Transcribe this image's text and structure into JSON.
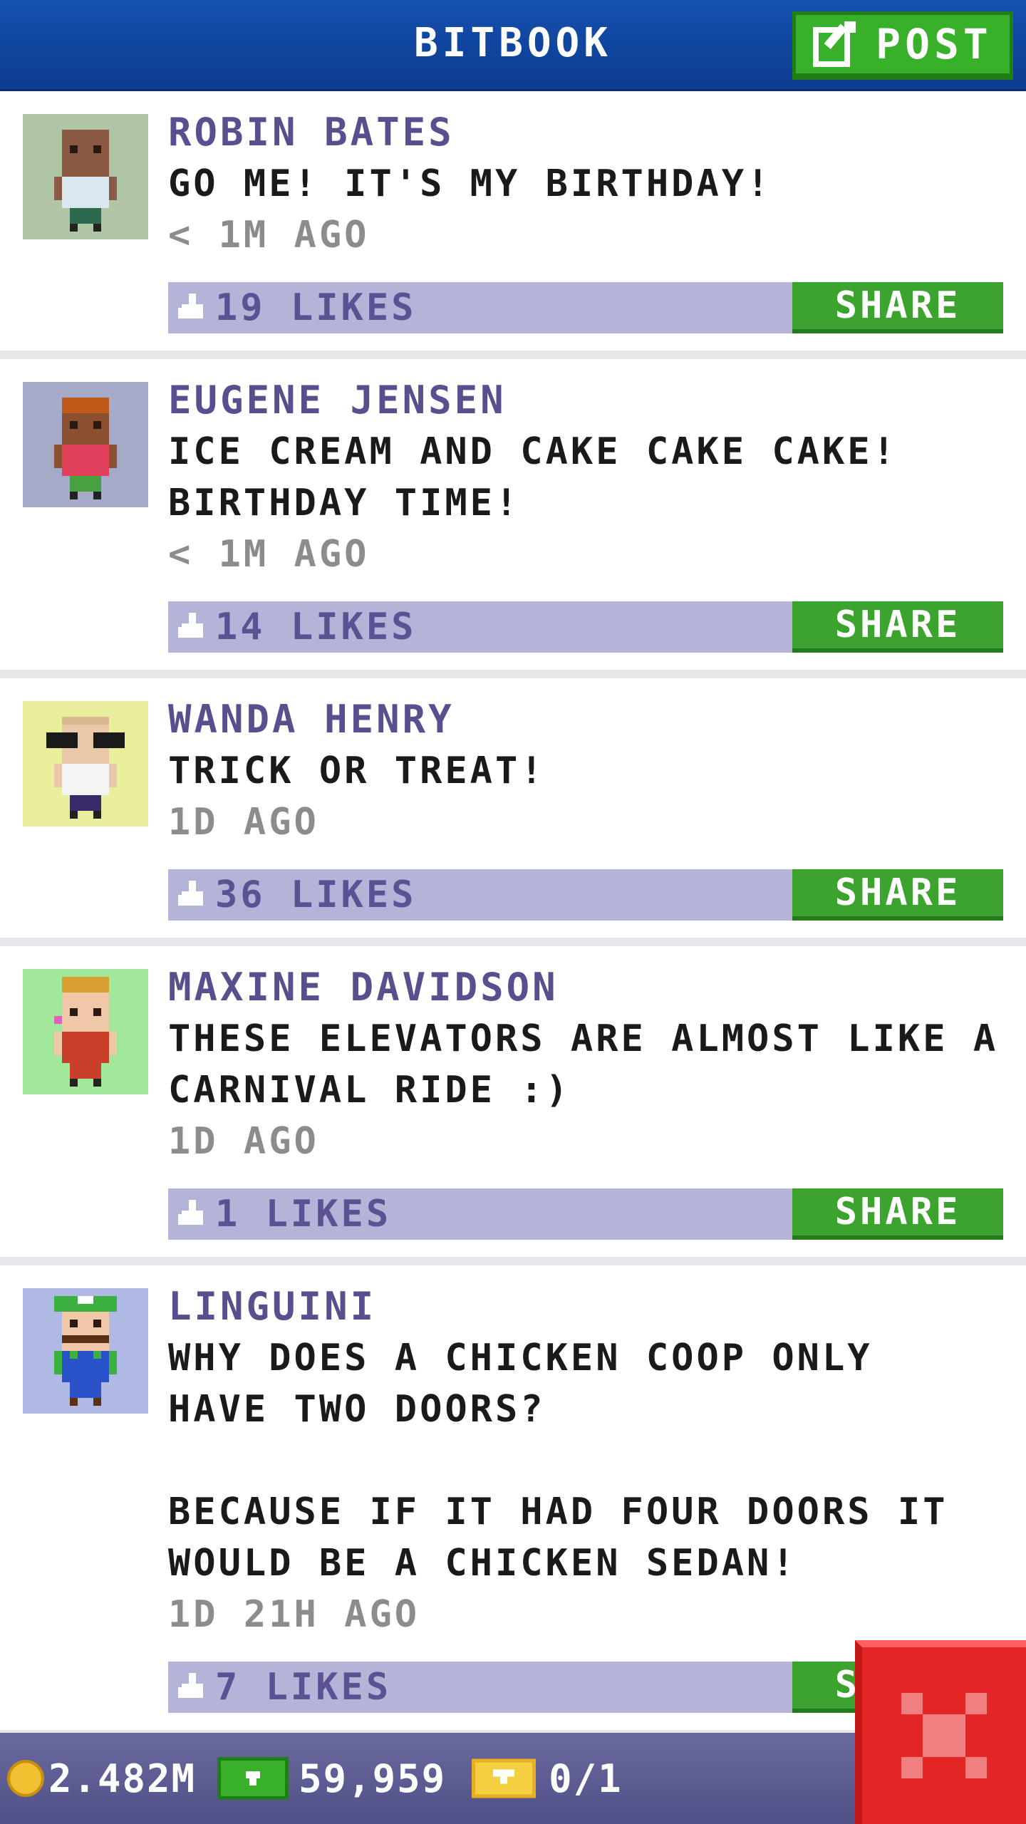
{
  "header": {
    "title": "BITBOOK",
    "post_label": "POST",
    "post_icon": "edit-icon"
  },
  "colors": {
    "header": "#0c3c8f",
    "accent_green": "#3da32f",
    "author_purple": "#58508e",
    "likes_bar": "#b4b4d8",
    "close_red": "#e32626"
  },
  "posts": [
    {
      "author": "ROBIN BATES",
      "message": "GO ME! IT'S MY BIRTHDAY!",
      "time": "< 1M AGO",
      "likes": "19 LIKES",
      "share": "SHARE",
      "avatar_bg": "#b0c4a6"
    },
    {
      "author": "EUGENE JENSEN",
      "message": "ICE CREAM AND CAKE CAKE CAKE!\nBIRTHDAY TIME!",
      "time": "< 1M AGO",
      "likes": "14 LIKES",
      "share": "SHARE",
      "avatar_bg": "#a4aac8"
    },
    {
      "author": "WANDA HENRY",
      "message": "TRICK OR TREAT!",
      "time": "1D AGO",
      "likes": "36 LIKES",
      "share": "SHARE",
      "avatar_bg": "#e8ee9a"
    },
    {
      "author": "MAXINE DAVIDSON",
      "message": "THESE ELEVATORS ARE ALMOST LIKE A\nCARNIVAL RIDE :)",
      "time": "1D AGO",
      "likes": "1 LIKES",
      "share": "SHARE",
      "avatar_bg": "#a2e89a"
    },
    {
      "author": "LINGUINI",
      "message": "WHY DOES A CHICKEN COOP ONLY\nHAVE TWO DOORS?\n\nBECAUSE IF IT HAD FOUR DOORS IT\nWOULD BE A CHICKEN SEDAN!",
      "time": "1D 21H AGO",
      "likes": "7 LIKES",
      "share": "SHARE",
      "avatar_bg": "#b0b8e4"
    }
  ],
  "bottom_bar": {
    "coins": "2.482M",
    "bux": "59,959",
    "tickets": "0/1"
  },
  "icons": {
    "like": "thumbs-up-icon",
    "coin": "coin-icon",
    "bux": "bux-icon",
    "ticket": "ticket-icon",
    "close": "close-icon"
  }
}
